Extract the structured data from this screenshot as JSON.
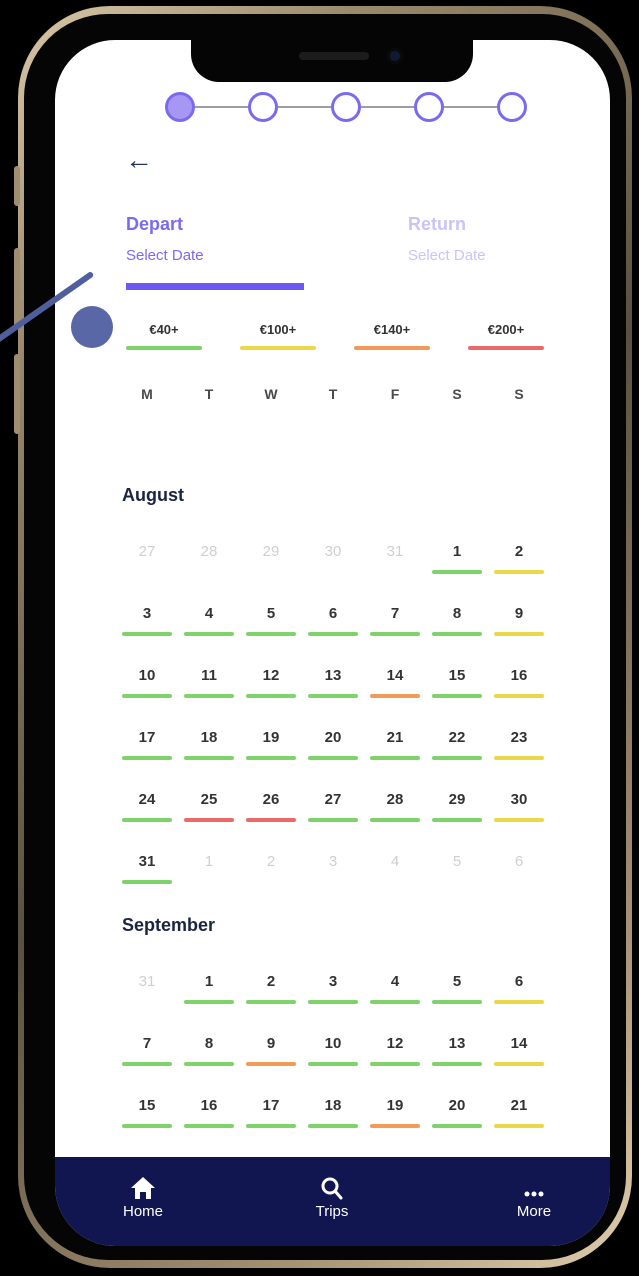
{
  "stepper": {
    "steps": 5,
    "active": 1
  },
  "nav": {
    "back_icon": "←"
  },
  "tabs": {
    "depart": {
      "title": "Depart",
      "subtitle": "Select Date"
    },
    "return": {
      "title": "Return",
      "subtitle": "Select Date"
    }
  },
  "legend": [
    {
      "label": "€40+",
      "color": "#7ed36a"
    },
    {
      "label": "€100+",
      "color": "#ecd64a"
    },
    {
      "label": "€140+",
      "color": "#f19a5a"
    },
    {
      "label": "€200+",
      "color": "#ea6a6a"
    }
  ],
  "weekdays": [
    "M",
    "T",
    "W",
    "T",
    "F",
    "S",
    "S"
  ],
  "months": [
    {
      "name": "August",
      "days": [
        {
          "d": "27",
          "m": true
        },
        {
          "d": "28",
          "m": true
        },
        {
          "d": "29",
          "m": true
        },
        {
          "d": "30",
          "m": true
        },
        {
          "d": "31",
          "m": true
        },
        {
          "d": "1",
          "p": "g"
        },
        {
          "d": "2",
          "p": "y"
        },
        {
          "d": "3",
          "p": "g"
        },
        {
          "d": "4",
          "p": "g"
        },
        {
          "d": "5",
          "p": "g"
        },
        {
          "d": "6",
          "p": "g"
        },
        {
          "d": "7",
          "p": "g"
        },
        {
          "d": "8",
          "p": "g"
        },
        {
          "d": "9",
          "p": "y"
        },
        {
          "d": "10",
          "p": "g"
        },
        {
          "d": "11",
          "p": "g"
        },
        {
          "d": "12",
          "p": "g"
        },
        {
          "d": "13",
          "p": "g"
        },
        {
          "d": "14",
          "p": "o"
        },
        {
          "d": "15",
          "p": "g"
        },
        {
          "d": "16",
          "p": "y"
        },
        {
          "d": "17",
          "p": "g"
        },
        {
          "d": "18",
          "p": "g"
        },
        {
          "d": "19",
          "p": "g"
        },
        {
          "d": "20",
          "p": "g"
        },
        {
          "d": "21",
          "p": "g"
        },
        {
          "d": "22",
          "p": "g"
        },
        {
          "d": "23",
          "p": "y"
        },
        {
          "d": "24",
          "p": "g"
        },
        {
          "d": "25",
          "p": "r"
        },
        {
          "d": "26",
          "p": "r"
        },
        {
          "d": "27",
          "p": "g"
        },
        {
          "d": "28",
          "p": "g"
        },
        {
          "d": "29",
          "p": "g"
        },
        {
          "d": "30",
          "p": "y"
        },
        {
          "d": "31",
          "p": "g"
        },
        {
          "d": "1",
          "m": true
        },
        {
          "d": "2",
          "m": true
        },
        {
          "d": "3",
          "m": true
        },
        {
          "d": "4",
          "m": true
        },
        {
          "d": "5",
          "m": true
        },
        {
          "d": "6",
          "m": true
        }
      ]
    },
    {
      "name": "September",
      "days": [
        {
          "d": "31",
          "m": true
        },
        {
          "d": "1",
          "p": "g"
        },
        {
          "d": "2",
          "p": "g"
        },
        {
          "d": "3",
          "p": "g"
        },
        {
          "d": "4",
          "p": "g"
        },
        {
          "d": "5",
          "p": "g"
        },
        {
          "d": "6",
          "p": "y"
        },
        {
          "d": "7",
          "p": "g"
        },
        {
          "d": "8",
          "p": "g"
        },
        {
          "d": "9",
          "p": "o"
        },
        {
          "d": "10",
          "p": "g"
        },
        {
          "d": "12",
          "p": "g"
        },
        {
          "d": "13",
          "p": "g"
        },
        {
          "d": "14",
          "p": "y"
        },
        {
          "d": "15",
          "p": "g"
        },
        {
          "d": "16",
          "p": "g"
        },
        {
          "d": "17",
          "p": "g"
        },
        {
          "d": "18",
          "p": "g"
        },
        {
          "d": "19",
          "p": "o"
        },
        {
          "d": "20",
          "p": "g"
        },
        {
          "d": "21",
          "p": "y"
        }
      ]
    }
  ],
  "price_colors": {
    "g": "#7ed36a",
    "y": "#ecd64a",
    "o": "#f19a5a",
    "r": "#ea6a6a"
  },
  "tabbar": [
    {
      "label": "Home",
      "icon": "home-icon"
    },
    {
      "label": "Trips",
      "icon": "search-icon"
    },
    {
      "label": "More",
      "icon": "more-icon"
    }
  ]
}
